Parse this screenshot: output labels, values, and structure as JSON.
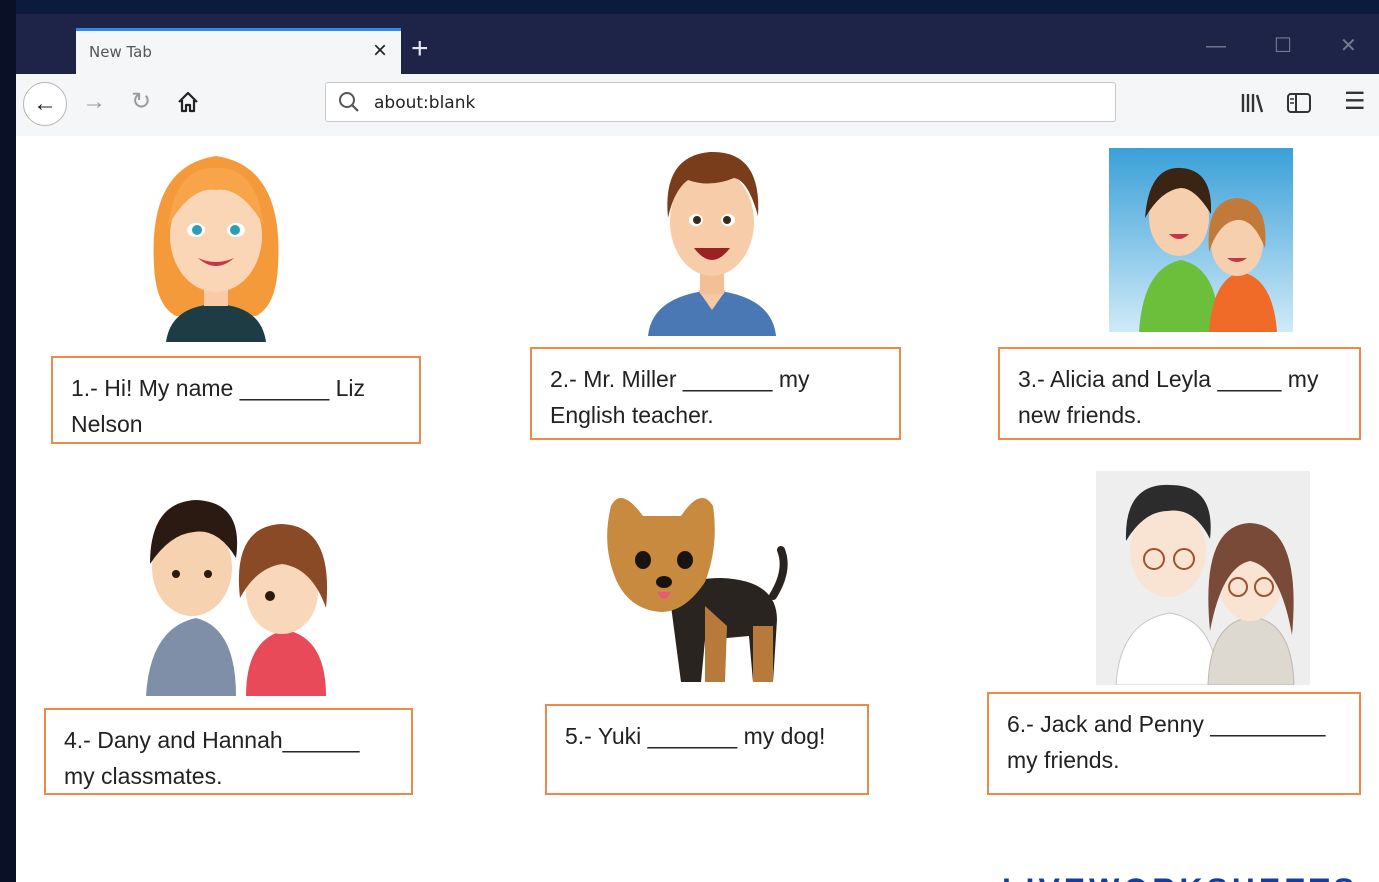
{
  "browser": {
    "tab_title": "New Tab",
    "tab_close": "×",
    "new_tab": "+",
    "minimize": "—",
    "maximize": "☐",
    "close": "✕",
    "back": "←",
    "forward": "→",
    "reload": "↻",
    "url": "about:blank",
    "menu": "☰"
  },
  "worksheet": {
    "questions": [
      {
        "text": "1.- Hi! My name _______ Liz Nelson"
      },
      {
        "text": "2.- Mr. Miller _______ my English teacher."
      },
      {
        "text": "3.- Alicia and Leyla _____ my new friends."
      },
      {
        "text": "4.- Dany and Hannah______ my classmates."
      },
      {
        "text": "5.- Yuki _______ my dog!"
      },
      {
        "text": "6.- Jack and Penny _________ my friends."
      }
    ],
    "watermark": "LIVEWORKSHEETS"
  },
  "colors": {
    "box_border": "#ec8a4c",
    "tabbar": "#1e2448",
    "tab_accent": "#2a8af0"
  }
}
